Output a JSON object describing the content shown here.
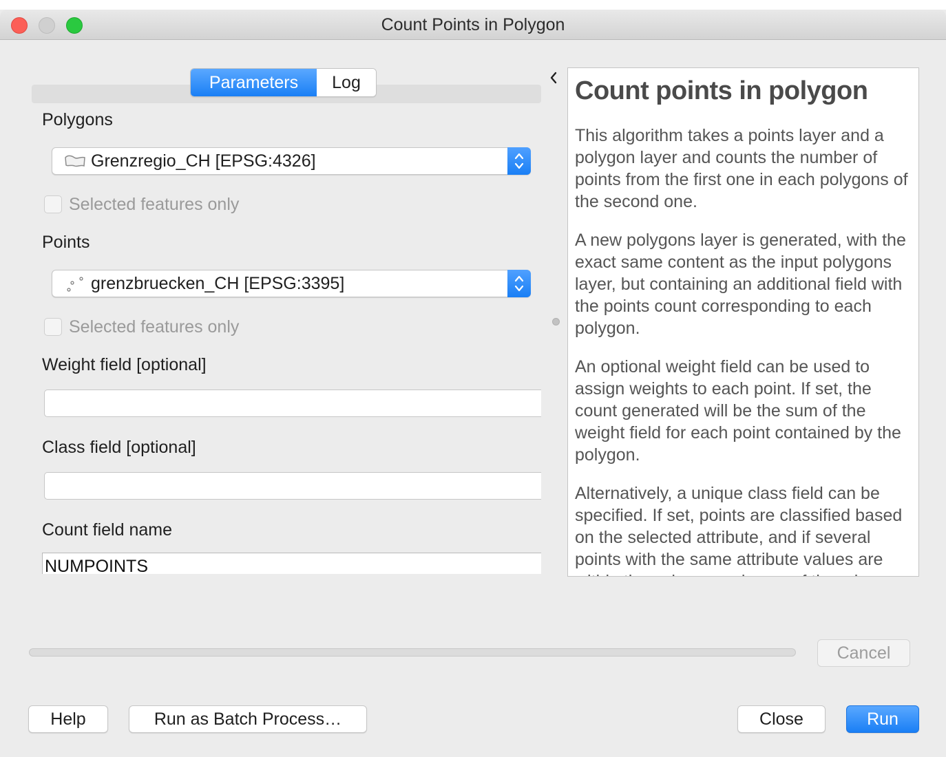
{
  "window": {
    "title": "Count Points in Polygon"
  },
  "tabs": [
    {
      "label": "Parameters",
      "active": true
    },
    {
      "label": "Log",
      "active": false
    }
  ],
  "parameters": {
    "polygons": {
      "label": "Polygons",
      "value": "Grenzregio_CH [EPSG:4326]",
      "icon": "polygon-layer-icon",
      "selected_only": {
        "label": "Selected features only",
        "checked": false,
        "enabled": false
      }
    },
    "points": {
      "label": "Points",
      "value": "grenzbruecken_CH [EPSG:3395]",
      "icon": "point-layer-icon",
      "selected_only": {
        "label": "Selected features only",
        "checked": false,
        "enabled": false
      }
    },
    "weight_field": {
      "label": "Weight field [optional]",
      "value": ""
    },
    "class_field": {
      "label": "Class field [optional]",
      "value": ""
    },
    "count_field": {
      "label": "Count field name",
      "value": "NUMPOINTS"
    }
  },
  "help": {
    "title": "Count points in polygon",
    "paragraphs": [
      "This algorithm takes a points layer and a polygon layer and counts the number of points from the first one in each polygons of the second one.",
      "A new polygons layer is generated, with the exact same content as the input polygons layer, but containing an additional field with the points count corresponding to each polygon.",
      "An optional weight field can be used to assign weights to each point. If set, the count generated will be the sum of the weight field for each point contained by the polygon.",
      "Alternatively, a unique class field can be specified. If set, points are classified based on the selected attribute, and if several points with the same attribute values are within the polygon, only one of them is counted."
    ]
  },
  "progress": {
    "value": 0
  },
  "buttons": {
    "cancel": "Cancel",
    "help": "Help",
    "batch": "Run as Batch Process…",
    "close": "Close",
    "run": "Run"
  },
  "colors": {
    "accent": "#1a7ff5",
    "close_light": "#fc5f57",
    "max_light": "#2ac940"
  }
}
